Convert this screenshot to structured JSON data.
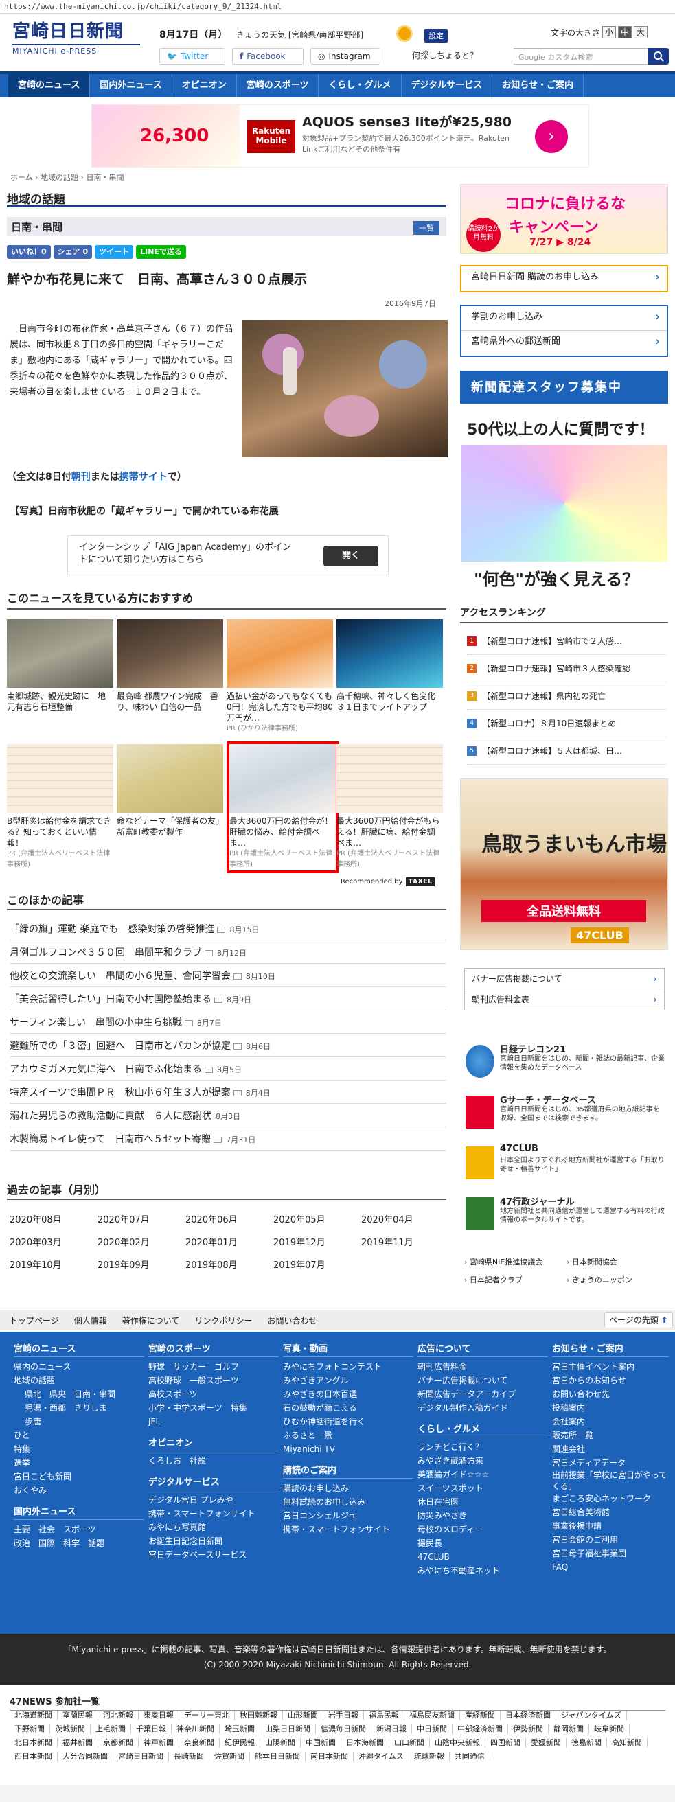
{
  "url": "https://www.the-miyanichi.co.jp/chiiki/category_9/_21324.html",
  "header": {
    "logo_main": "宮崎日日新聞",
    "logo_sub": "MIYANICHI e-PRESS",
    "date": "8月17日（月）",
    "weather": "きょうの天気 [宮崎県/南部平野部]",
    "settings": "設定",
    "font_size_label": "文字の大きさ",
    "font_small": "小",
    "font_mid": "中",
    "font_large": "大",
    "twitter": "Twitter",
    "facebook": "Facebook",
    "instagram": "Instagram",
    "question": "何探しちょると？",
    "search_placeholder": "Google カスタム検索"
  },
  "nav": [
    "宮崎のニュース",
    "国内外ニュース",
    "オピニオン",
    "宮崎のスポーツ",
    "くらし・グルメ",
    "デジタルサービス",
    "お知らせ・ご案内"
  ],
  "ad_top": {
    "price": "26,300",
    "brand": "Rakuten Mobile",
    "title": "AQUOS sense3 liteが¥25,980",
    "desc": "対象製品+プラン契約で最大26,300ポイント還元。Rakuten Linkご利用などその他条件有"
  },
  "breadcrumb": "ホーム › 地域の話題 › 日南・串間",
  "section_title": "地域の話題",
  "subsection_title": "日南・串間",
  "list_label": "一覧",
  "shares": {
    "like": "いいね！0",
    "share": "シェア 0",
    "tweet": "ツイート",
    "line": "LINEで送る"
  },
  "article": {
    "title": "鮮やか布花見に来て　日南、髙草さん３００点展示",
    "date": "2016年9月7日",
    "body": "　日南市今町の布花作家・髙草京子さん（６７）の作品展は、同市秋肥８丁目の多目的空間「ギャラリーこだま」敷地内にある「蔵ギャラリー」で開かれている。四季折々の花々を色鮮やかに表現した作品約３００点が、来場者の目を楽しませている。１０月２日まで。",
    "full_prefix": "（全文は8日付",
    "full_link1": "朝刊",
    "full_mid": "または",
    "full_link2": "携帯サイト",
    "full_suffix": "で）",
    "caption": "【写真】日南市秋肥の「蔵ギャラリー」で開かれている布花展"
  },
  "ad_mid": {
    "text": "インターンシップ「AIG Japan Academy」のポイントについて知りたい方はこちら",
    "button": "開く"
  },
  "recommend_title": "このニュースを見ている方におすすめ",
  "recommend": [
    {
      "text": "南郷城跡、観光史跡に　地元有志ら石垣整備",
      "pr": ""
    },
    {
      "text": "最高峰 都農ワイン完成　香り、味わい 自信の一品",
      "pr": ""
    },
    {
      "text": "過払い金があってもなくても0円！完済した方でも平均80万円が…",
      "pr": "PR (ひかり法律事務所)"
    },
    {
      "text": "高千穂峡、神々しく色変化　３１日までライトアップ",
      "pr": ""
    },
    {
      "text": "B型肝炎は給付金を請求できる？知っておくといい情報！",
      "pr": "PR (弁護士法人ベリーベスト法律事務所)"
    },
    {
      "text": "命などテーマ「保護者の友」　新富町教委が製作",
      "pr": ""
    },
    {
      "text": "最大3600万円の給付金が！肝臓の悩み、給付金調べま…",
      "pr": "PR (弁護士法人ベリーベスト法律事務所)"
    },
    {
      "text": "最大3600万円給付金がもらえる！肝臓に病、給付金調べま…",
      "pr": "PR (弁護士法人ベリーベスト法律事務所)"
    }
  ],
  "recommended_by": "Recommended by",
  "recommended_brand": "TAXEL",
  "other_title": "このほかの記事",
  "other": [
    {
      "t": "「緑の旗」運動 楽庭でも　感染対策の啓発推進",
      "d": "8月15日"
    },
    {
      "t": "月例ゴルフコンペ３５０回　串間平和クラブ",
      "d": "8月12日"
    },
    {
      "t": "他校との交流楽しい　串間の小６児童、合同学習会",
      "d": "8月10日"
    },
    {
      "t": "「美会話習得したい」日南で小村国際塾始まる",
      "d": "8月9日"
    },
    {
      "t": "サーフィン楽しい　串間の小中生ら挑戦",
      "d": "8月7日"
    },
    {
      "t": "避難所での「３密」回避へ　日南市とパカンが協定",
      "d": "8月6日"
    },
    {
      "t": "アカウミガメ元気に海へ　日南でふ化始まる",
      "d": "8月5日"
    },
    {
      "t": "特産スイーツで串間ＰＲ　秋山小６年生３人が提案",
      "d": "8月4日"
    },
    {
      "t": "溺れた男児らの救助活動に貢献　６人に感謝状",
      "d": "8月3日"
    },
    {
      "t": "木製簡易トイレ使って　日南市へ５セット寄贈",
      "d": "7月31日"
    }
  ],
  "past_title": "過去の記事（月別）",
  "months": [
    "2020年08月",
    "2020年07月",
    "2020年06月",
    "2020年05月",
    "2020年04月",
    "2020年03月",
    "2020年02月",
    "2020年01月",
    "2019年12月",
    "2019年11月",
    "2019年10月",
    "2019年09月",
    "2019年08月",
    "2019年07月"
  ],
  "sidebar": {
    "covid_a": "コロナに負けるな",
    "covid_b": "キャンペーン",
    "covid_c": "7/27 ▶ 8/24",
    "covid_badge": "購読料2か月無料",
    "subscribe": "宮崎日日新聞 購読のお申し込み",
    "study": "学割のお申し込み",
    "mail": "宮崎県外への郵送新聞",
    "staff": "新聞配達スタッフ募集中",
    "adq_top": "50代以上の人に質問です！",
    "adq_bot": "\"何色\"が強く見える？",
    "ranking_title": "アクセスランキング",
    "ranking": [
      "【新型コロナ速報】宮崎市で２人感…",
      "【新型コロナ速報】宮崎市３人感染確認",
      "【新型コロナ速報】県内初の死亡",
      "【新型コロナ】８月10日速報まとめ",
      "【新型コロナ速報】５人は都城、日…"
    ],
    "fish_title": "鳥取うまいもん市場",
    "fish_sale": "全品送料無料",
    "fish_club": "47CLUB",
    "banner": "バナー広告掲載について",
    "rate": "朝刊広告料金表",
    "services": [
      {
        "t": "日経テレコン21",
        "d": "宮崎日日新聞をはじめ、新聞・雑誌の最新記事、企業情報を集めたデータベース"
      },
      {
        "t": "Gサーチ・データベース",
        "d": "宮崎日日新聞をはじめ、35都道府県の地方紙記事を収録、全国までは検索できます。"
      },
      {
        "t": "47CLUB",
        "d": "日本全国よりすぐれる地方新聞社が運営する「お取り寄せ・積善サイト」"
      },
      {
        "t": "47行政ジャーナル",
        "d": "地方新聞社と共同通信が運営して運営する有料の行政情報のポータルサイトです。"
      }
    ],
    "orgs": [
      "宮崎県NIE推進協議会",
      "日本新聞協会",
      "日本記者クラブ",
      "きょうのニッポン"
    ]
  },
  "footer_nav": [
    "トップページ",
    "個人情報",
    "著作権について",
    "リンクポリシー",
    "お問い合わせ"
  ],
  "back_top": "ページの先頭",
  "footer": {
    "c1h": "宮崎のニュース",
    "c1": [
      "県内のニュース",
      "地域の話題"
    ],
    "c1sub": [
      [
        "県北",
        "県央",
        "日南・串間"
      ],
      [
        "児湯・西都",
        "きりしま"
      ],
      [
        "歩唐"
      ]
    ],
    "c1b": [
      "ひと",
      "特集",
      "選挙",
      "宮日こども新聞",
      "おくやみ"
    ],
    "c1h2": "国内外ニュース",
    "c1c": [
      [
        "主要",
        "社会",
        "スポーツ"
      ],
      [
        "政治",
        "国際",
        "科学",
        "話題"
      ]
    ],
    "c2h": "宮崎のスポーツ",
    "c2": [
      [
        "野球",
        "サッカー",
        "ゴルフ"
      ],
      [
        "高校野球",
        "一般スポーツ"
      ],
      [
        "高校スポーツ"
      ],
      [
        "小学・中学スポーツ",
        "特集"
      ],
      [
        "JFL"
      ]
    ],
    "c2h2": "オピニオン",
    "c2b": [
      [
        "くろしお",
        "社説"
      ]
    ],
    "c2h3": "デジタルサービス",
    "c2c": [
      "デジタル宮日 プレみや",
      "携帯・スマートフォンサイト",
      "みやにち写真館",
      "お誕生日記念日新聞",
      "宮日データベースサービス"
    ],
    "c3h": "写真・動画",
    "c3": [
      "みやにちフォトコンテスト",
      "みやざきアングル",
      "みやざきの日本百選",
      "石の鼓動が聴こえる",
      "ひむか神話街道を行く",
      "ふるさと一景",
      "Miyanichi TV"
    ],
    "c3h2": "購読のご案内",
    "c3b": [
      "購読のお申し込み",
      "無料試読のお申し込み",
      "宮日コンシェルジュ",
      "携帯・スマートフォンサイト"
    ],
    "c4h": "広告について",
    "c4": [
      "朝刊広告料金",
      "バナー広告掲載について",
      "新聞広告データアーカイブ",
      "デジタル制作入稿ガイド"
    ],
    "c4h2": "くらし・グルメ",
    "c4b": [
      "ランチどこ行く？",
      "みやざき蔵酒方来",
      "美酒論ガイド☆☆☆",
      "スイーツスポット",
      "休日在宅医",
      "防災みやざき",
      "母校のメロディー",
      "撮民長",
      "47CLUB",
      "みやにち不動産ネット"
    ],
    "c5h": "お知らせ・ご案内",
    "c5": [
      "宮日主催イベント案内",
      "宮日からのお知らせ",
      "お問い合わせ先",
      "投稿案内",
      "会社案内",
      "販売所一覧",
      "関連会社",
      "宮日メディアデータ",
      "出前授業「学校に宮日がやってくる」",
      "まごころ安心ネットワーク",
      "宮日総合美術館",
      "事業後援申請",
      "宮日会館のご利用",
      "宮日母子福祉事業団",
      "FAQ"
    ]
  },
  "copyright": "「Miyanichi e-press」に掲載の記事、写真、音楽等の著作権は宮崎日日新聞社または、各情報提供者にあります。無断転載、無断使用を禁じます。",
  "copyright2": "(C) 2000-2020 Miyazaki Nichinichi Shimbun. All Rights Reserved.",
  "news47_title": "47NEWS 参加社一覧",
  "news47": [
    "北海道新聞",
    "室蘭民報",
    "河北新報",
    "東奥日報",
    "デーリー東北",
    "秋田魁新報",
    "山形新聞",
    "岩手日報",
    "福島民報",
    "福島民友新聞",
    "産経新聞",
    "日本経済新聞",
    "ジャパンタイムズ",
    "下野新聞",
    "茨城新聞",
    "上毛新聞",
    "千葉日報",
    "神奈川新聞",
    "埼玉新聞",
    "山梨日日新聞",
    "信濃毎日新聞",
    "新潟日報",
    "中日新聞",
    "中部経済新聞",
    "伊勢新聞",
    "静岡新聞",
    "岐阜新聞",
    "北日本新聞",
    "福井新聞",
    "京都新聞",
    "神戸新聞",
    "奈良新聞",
    "紀伊民報",
    "山陽新聞",
    "中国新聞",
    "日本海新聞",
    "山口新聞",
    "山陰中央新報",
    "四国新聞",
    "愛媛新聞",
    "徳島新聞",
    "高知新聞",
    "西日本新聞",
    "大分合同新聞",
    "宮崎日日新聞",
    "長崎新聞",
    "佐賀新聞",
    "熊本日日新聞",
    "南日本新聞",
    "沖縄タイムス",
    "琉球新報",
    "共同通信"
  ],
  "colors": {
    "brand": "#1b3a8c",
    "nav": "#1b62b8",
    "highlight": "#e00000"
  }
}
